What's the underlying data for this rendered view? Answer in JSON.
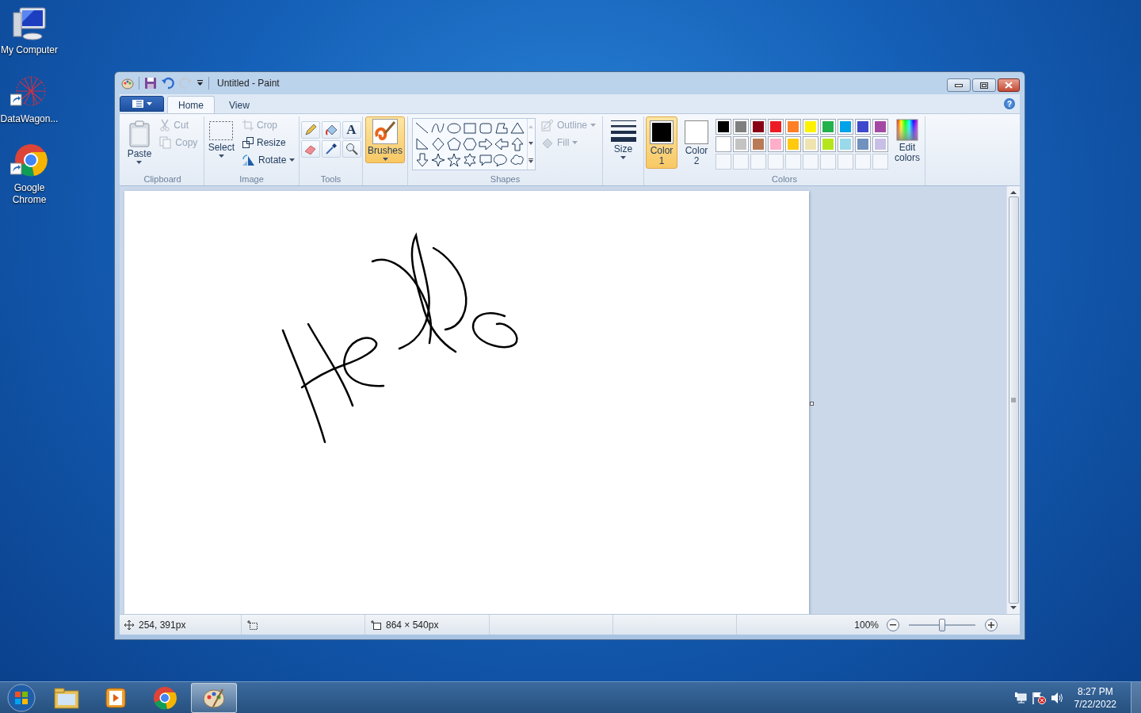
{
  "desktop_icons": [
    {
      "label": "My Computer",
      "kind": "computer"
    },
    {
      "label": "DataWagon...",
      "kind": "app"
    },
    {
      "label": "Google Chrome",
      "kind": "chrome"
    }
  ],
  "window": {
    "title": "Untitled - Paint",
    "help": "?"
  },
  "ribbon": {
    "tabs": [
      {
        "label": "Home",
        "selected": true
      },
      {
        "label": "View",
        "selected": false
      }
    ],
    "clipboard": {
      "label": "Clipboard",
      "paste": "Paste",
      "cut": {
        "label": "Cut",
        "disabled": true
      },
      "copy": {
        "label": "Copy",
        "disabled": true
      }
    },
    "image": {
      "label": "Image",
      "select": "Select",
      "crop": {
        "label": "Crop",
        "disabled": true
      },
      "resize": {
        "label": "Resize",
        "disabled": false
      },
      "rotate": {
        "label": "Rotate",
        "disabled": false
      }
    },
    "tools": {
      "label": "Tools",
      "text_glyph": "A"
    },
    "brushes": {
      "label": "Brushes",
      "selected": true
    },
    "shapes": {
      "label": "Shapes",
      "outline": {
        "label": "Outline",
        "disabled": true
      },
      "fill": {
        "label": "Fill",
        "disabled": true
      }
    },
    "size": {
      "label": "Size"
    },
    "colors": {
      "label": "Colors",
      "color1": {
        "label": "Color 1",
        "selected": true,
        "color": "#000000"
      },
      "color2": {
        "label": "Color 2",
        "selected": false,
        "color": "#ffffff"
      },
      "palette": [
        {
          "color": "#000000"
        },
        {
          "color": "#7f7f7f"
        },
        {
          "color": "#880015"
        },
        {
          "color": "#ed1c24"
        },
        {
          "color": "#ff7f27"
        },
        {
          "color": "#fff200"
        },
        {
          "color": "#22b14c"
        },
        {
          "color": "#00a2e8"
        },
        {
          "color": "#3f48cc"
        },
        {
          "color": "#a349a4"
        },
        {
          "color": "#ffffff"
        },
        {
          "color": "#c3c3c3"
        },
        {
          "color": "#b97a57"
        },
        {
          "color": "#ffaec9"
        },
        {
          "color": "#ffc90e"
        },
        {
          "color": "#efe4b0"
        },
        {
          "color": "#b5e61d"
        },
        {
          "color": "#99d9ea"
        },
        {
          "color": "#7092be"
        },
        {
          "color": "#c8bfe7"
        }
      ],
      "edit_colors": "Edit colors"
    }
  },
  "status_bar": {
    "cursor": "254, 391px",
    "size": "864 × 540px",
    "zoom": "100%",
    "zoom_slider": {
      "level": 0.5
    }
  },
  "taskbar": {
    "items": [
      {
        "kind": "explorer",
        "selected": false
      },
      {
        "kind": "media",
        "selected": false
      },
      {
        "kind": "chrome",
        "selected": false
      },
      {
        "kind": "paint",
        "selected": true
      }
    ],
    "time": "8:27 PM",
    "date": "7/22/2022"
  }
}
